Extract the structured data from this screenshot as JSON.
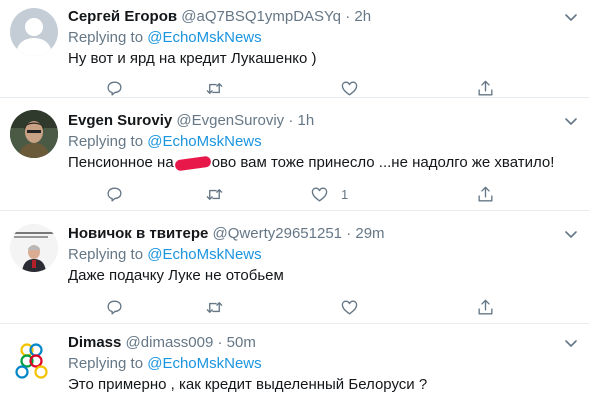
{
  "replying_to_label": "Replying to",
  "tweets": [
    {
      "name": "Сергей Егоров",
      "handle": "@aQ7BSQ1ympDASYq",
      "dot": "·",
      "time": "2h",
      "mention": "@EchoMskNews",
      "text": "Ну вот и ярд на кредит Лукашенко )",
      "likes": ""
    },
    {
      "name": "Evgen Suroviy",
      "handle": "@EvgenSuroviy",
      "dot": "·",
      "time": "1h",
      "mention": "@EchoMskNews",
      "text_before": "Пенсионное на",
      "text_after": "ово вам тоже принесло ...не надолго же хватило!",
      "likes": "1"
    },
    {
      "name": "Новичок в твитере",
      "handle": "@Qwerty29651251",
      "dot": "·",
      "time": "29m",
      "mention": "@EchoMskNews",
      "text": "Даже подачку Луке не отобьем",
      "likes": ""
    },
    {
      "name": "Dimass",
      "handle": "@dimass009",
      "dot": "·",
      "time": "50m",
      "mention": "@EchoMskNews",
      "text": "Это примерно , как кредит выделенный Белоруси ?",
      "likes": ""
    }
  ],
  "icons": {
    "reply": "reply-icon",
    "retweet": "retweet-icon",
    "like": "heart-icon",
    "share": "share-icon",
    "more": "chevron-down-icon"
  },
  "colors": {
    "text": "#14171a",
    "secondary": "#657786",
    "link": "#1b95e0",
    "divider": "#e6ecf0"
  }
}
